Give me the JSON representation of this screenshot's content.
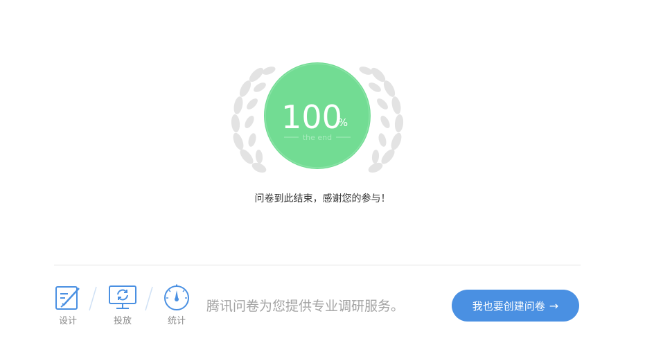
{
  "badge": {
    "percent_value": "100",
    "percent_sign": "%",
    "caption": "the end",
    "circle_color": "#72dc93",
    "laurel_color": "#e3e3e3"
  },
  "completion_message": "问卷到此结束，感谢您的参与！",
  "footer": {
    "steps": [
      {
        "label": "设计",
        "icon": "edit-icon"
      },
      {
        "label": "投放",
        "icon": "refresh-screen-icon"
      },
      {
        "label": "统计",
        "icon": "gauge-icon"
      }
    ],
    "slogan": "腾讯问卷为您提供专业调研服务。",
    "cta": {
      "label": "我也要创建问卷",
      "arrow": "→"
    },
    "accent_color": "#4a90e2",
    "icon_color": "#4a90e2"
  }
}
